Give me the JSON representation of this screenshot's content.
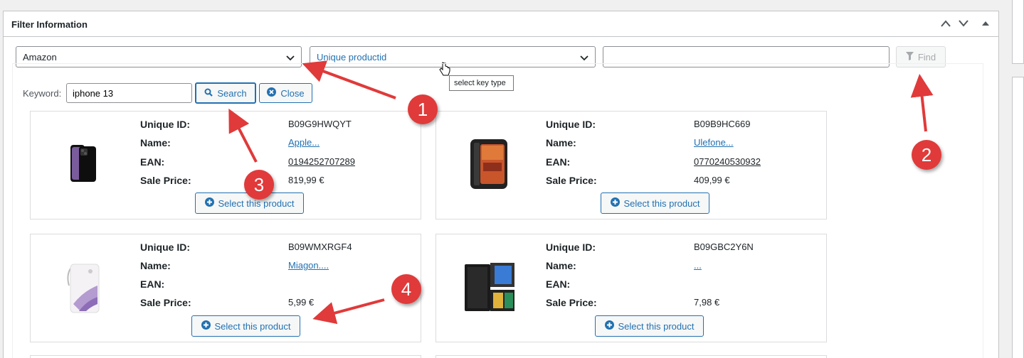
{
  "panel": {
    "title": "Filter Information"
  },
  "filters": {
    "store_select": "Amazon",
    "key_type_select": "Unique productid",
    "value_input": "",
    "find_label": "Find",
    "tooltip": "select key type"
  },
  "search": {
    "keyword_label": "Keyword:",
    "keyword_value": "iphone 13",
    "search_label": "Search",
    "close_label": "Close"
  },
  "labels": {
    "unique_id": "Unique ID:",
    "name": "Name:",
    "ean": "EAN:",
    "sale_price": "Sale Price:",
    "select": "Select this product"
  },
  "products": [
    {
      "unique_id": "B09G9HWQYT",
      "name": "Apple...",
      "ean": "0194252707289",
      "price": "819,99 €"
    },
    {
      "unique_id": "B09B9HC669",
      "name": "Ulefone...",
      "ean": "0770240530932",
      "price": "409,99 €"
    },
    {
      "unique_id": "B09WMXRGF4",
      "name": "Miagon....",
      "ean": "",
      "price": "5,99 €"
    },
    {
      "unique_id": "B09GBC2Y6N",
      "name": "...",
      "ean": "",
      "price": "7,98 €"
    }
  ],
  "annotations": [
    "1",
    "2",
    "3",
    "4"
  ],
  "colors": {
    "accent": "#2271b1",
    "annotation": "#e03a3a"
  }
}
